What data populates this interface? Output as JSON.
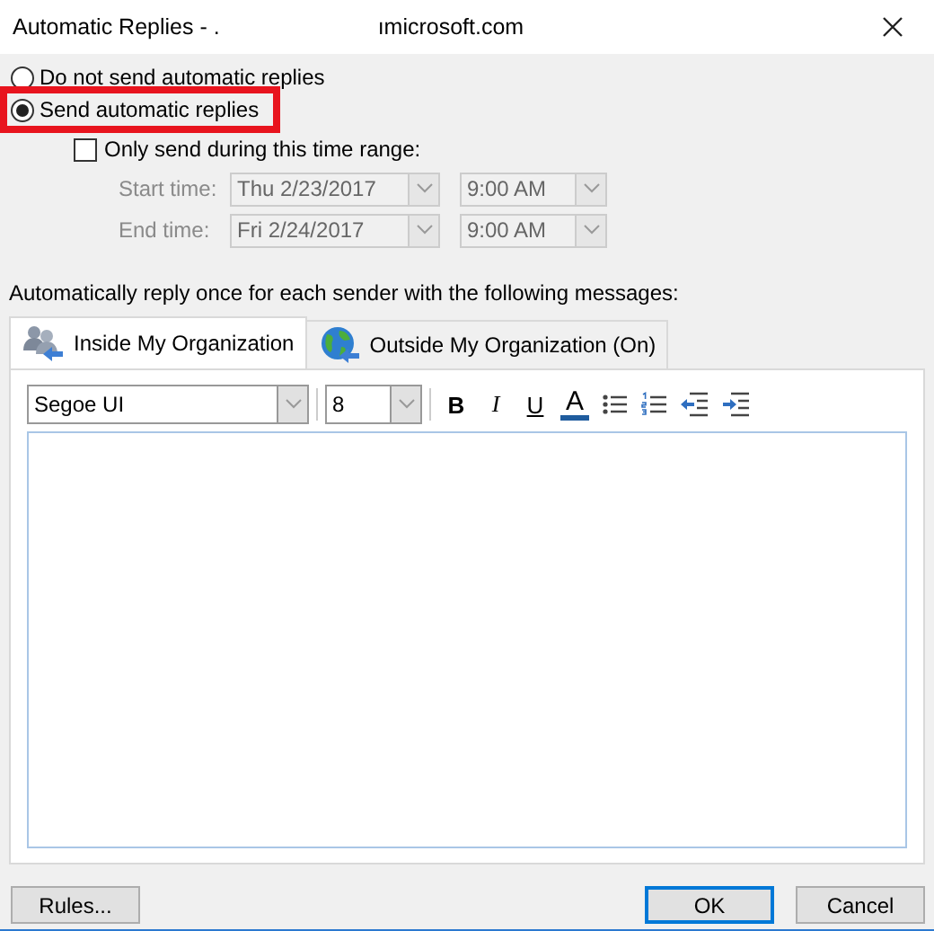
{
  "window": {
    "title_parts": [
      "Automatic Replies - .",
      "ımicrosoft.com"
    ]
  },
  "reply_options": [
    {
      "label": "Do not send automatic replies",
      "selected": false,
      "highlighted": false
    },
    {
      "label": "Send automatic replies",
      "selected": true,
      "highlighted": true
    }
  ],
  "time_range": {
    "label": "Only send during this time range:",
    "checked": false,
    "disabled": true,
    "rows": [
      {
        "label": "Start time:",
        "date": "Thu 2/23/2017",
        "time": "9:00 AM"
      },
      {
        "label": "End time:",
        "date": "Fri 2/24/2017",
        "time": "9:00 AM"
      }
    ]
  },
  "instruction": "Automatically reply once for each sender with the following messages:",
  "tabs": [
    {
      "label": "Inside My Organization",
      "selected": true,
      "kind": "people"
    },
    {
      "label": "Outside My Organization (On)",
      "selected": false,
      "kind": "globe"
    }
  ],
  "toolbar": {
    "font": "Segoe UI",
    "size": "8",
    "tools": [
      {
        "kind": "bold",
        "label": "B"
      },
      {
        "kind": "italic",
        "label": "I"
      },
      {
        "kind": "underline",
        "label": "U"
      },
      {
        "kind": "color",
        "label": "A"
      },
      {
        "kind": "bullets"
      },
      {
        "kind": "numbering"
      },
      {
        "kind": "outdent"
      },
      {
        "kind": "indent"
      }
    ]
  },
  "buttons": [
    {
      "label": "Rules...",
      "default": false
    },
    {
      "label": "OK",
      "default": true
    },
    {
      "label": "Cancel",
      "default": false
    }
  ]
}
